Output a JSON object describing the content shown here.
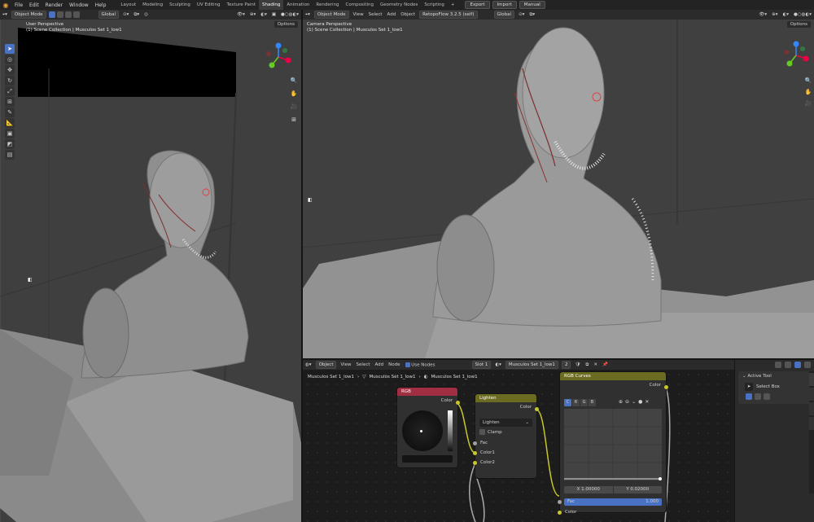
{
  "topbar": {
    "menus": [
      "File",
      "Edit",
      "Render",
      "Window",
      "Help"
    ],
    "workspaces": [
      "Layout",
      "Modeling",
      "Sculpting",
      "UV Editing",
      "Texture Paint",
      "Shading",
      "Animation",
      "Rendering",
      "Compositing",
      "Geometry Nodes",
      "Scripting"
    ],
    "active_workspace": "Shading",
    "right": {
      "export": "Export",
      "import": "Import",
      "manual": "Manual"
    }
  },
  "left_viewport": {
    "mode": "Object Mode",
    "orientation": "Global",
    "options": "Options",
    "perspective": "User Perspective",
    "collection": "(1) Scene Collection | Musculos Set 1_low1"
  },
  "right_viewport": {
    "mode": "Object Mode",
    "menus": [
      "View",
      "Select",
      "Add",
      "Object"
    ],
    "addon": "RetopoFlow 3.2.5 (self)",
    "orientation": "Global",
    "options": "Options",
    "perspective": "Camera Perspective",
    "collection": "(1) Scene Collection | Musculos Set 1_low1"
  },
  "node_editor": {
    "type": "Object",
    "menus": [
      "View",
      "Select",
      "Add",
      "Node"
    ],
    "use_nodes": "Use Nodes",
    "slot": "Slot 1",
    "material": "Musculos Set 1_low1",
    "users": "2",
    "breadcrumb": [
      "Musculos Set 1_low1",
      "Musculos Set 1_low1",
      "Musculos Set 1_low1"
    ],
    "rgb_node": {
      "title": "RGB",
      "out": "Color"
    },
    "lighten_node": {
      "title": "Lighten",
      "out": "Color",
      "blend": "Lighten",
      "clamp": "Clamp",
      "fac": "Fac",
      "color1": "Color1",
      "color2": "Color2"
    },
    "curves_node": {
      "title": "RGB Curves",
      "out": "Color",
      "channels": [
        "C",
        "R",
        "G",
        "B"
      ],
      "x_field": "X 1.00000",
      "y_field": "Y 0.02000",
      "fac_label": "Fac",
      "fac_value": "1.000",
      "in": "Color"
    }
  },
  "sidebar": {
    "title": "Active Tool",
    "tool": "Select Box"
  },
  "colors": {
    "accent": "#4a72c4",
    "rgb_header": "#a22e44",
    "lighten_header": "#6b6b22",
    "curves_header": "#6b6b22"
  }
}
